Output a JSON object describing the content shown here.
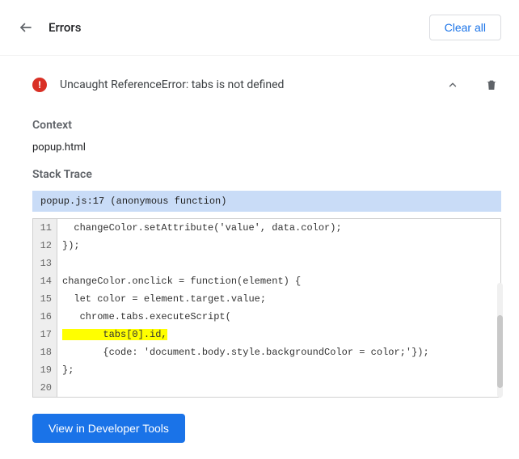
{
  "header": {
    "title": "Errors",
    "clear_all": "Clear all"
  },
  "error": {
    "message": "Uncaught ReferenceError: tabs is not defined"
  },
  "sections": {
    "context_heading": "Context",
    "context_value": "popup.html",
    "trace_heading": "Stack Trace",
    "trace_bar": "popup.js:17 (anonymous function)"
  },
  "code": {
    "lines": [
      {
        "n": 11,
        "text": "  changeColor.setAttribute('value', data.color);",
        "hl": false
      },
      {
        "n": 12,
        "text": "});",
        "hl": false
      },
      {
        "n": 13,
        "text": "",
        "hl": false
      },
      {
        "n": 14,
        "text": "changeColor.onclick = function(element) {",
        "hl": false
      },
      {
        "n": 15,
        "text": "  let color = element.target.value;",
        "hl": false
      },
      {
        "n": 16,
        "text": "   chrome.tabs.executeScript(",
        "hl": false
      },
      {
        "n": 17,
        "text": "       tabs[0].id,",
        "hl": true
      },
      {
        "n": 18,
        "text": "       {code: 'document.body.style.backgroundColor = color;'});",
        "hl": false
      },
      {
        "n": 19,
        "text": "};",
        "hl": false
      },
      {
        "n": 20,
        "text": "",
        "hl": false
      }
    ]
  },
  "footer": {
    "view_devtools": "View in Developer Tools"
  }
}
